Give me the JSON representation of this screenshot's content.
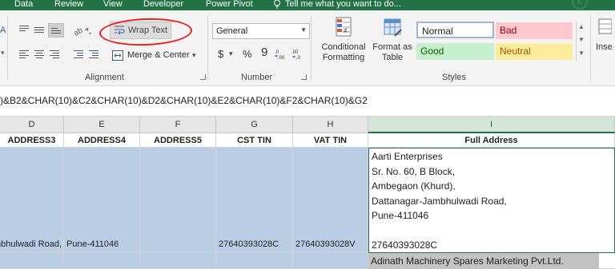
{
  "menu": {
    "tabs": [
      "Data",
      "Review",
      "View",
      "Developer",
      "Power Pivot"
    ],
    "tell_me": "Tell me what you want to do...",
    "logo": "K"
  },
  "ribbon": {
    "alignment": {
      "wrap_text": "Wrap Text",
      "merge_center": "Merge & Center",
      "label": "Alignment"
    },
    "number": {
      "format_value": "General",
      "currency": "$",
      "percent": "%",
      "comma": "9",
      "label": "Number"
    },
    "styles": {
      "conditional_formatting": [
        "Conditional",
        "Formatting"
      ],
      "format_as_table": [
        "Format as",
        "Table"
      ],
      "normal": "Normal",
      "bad": "Bad",
      "good": "Good",
      "neutral": "Neutral",
      "label": "Styles"
    },
    "insert_partial": "Inse"
  },
  "formula_bar": {
    "text": ")&B2&CHAR(10)&C2&CHAR(10)&D2&CHAR(10)&E2&CHAR(10)&F2&CHAR(10)&G2"
  },
  "columns": [
    "D",
    "E",
    "F",
    "G",
    "H",
    "I"
  ],
  "headers": [
    "ADDRESS3",
    "ADDRESS4",
    "ADDRESS5",
    "CST TIN",
    "VAT TIN",
    "Full Address"
  ],
  "row2": {
    "address3": "Dattanagar-Jambhulwadi Road,",
    "address4": "Pune-411046",
    "address5": "",
    "cst_tin": "27640393028C",
    "vat_tin": "27640393028V",
    "full_address_lines": [
      "Aarti Enterprises",
      "Sr. No. 60, B Block,",
      "Ambegaon (Khurd),",
      "Dattanagar-Jambhulwadi Road,",
      "Pune-411046",
      "",
      "27640393028C"
    ]
  },
  "row3": {
    "full_address": "Adinath Machinery Spares Marketing Pvt.Ltd."
  },
  "colors": {
    "excel_green": "#217346",
    "selection_blue": "#b9cde4",
    "annotation_red": "#e8201f",
    "bad_bg": "#ffc7ce",
    "good_bg": "#c6efce",
    "neutral_bg": "#ffeb9c"
  }
}
